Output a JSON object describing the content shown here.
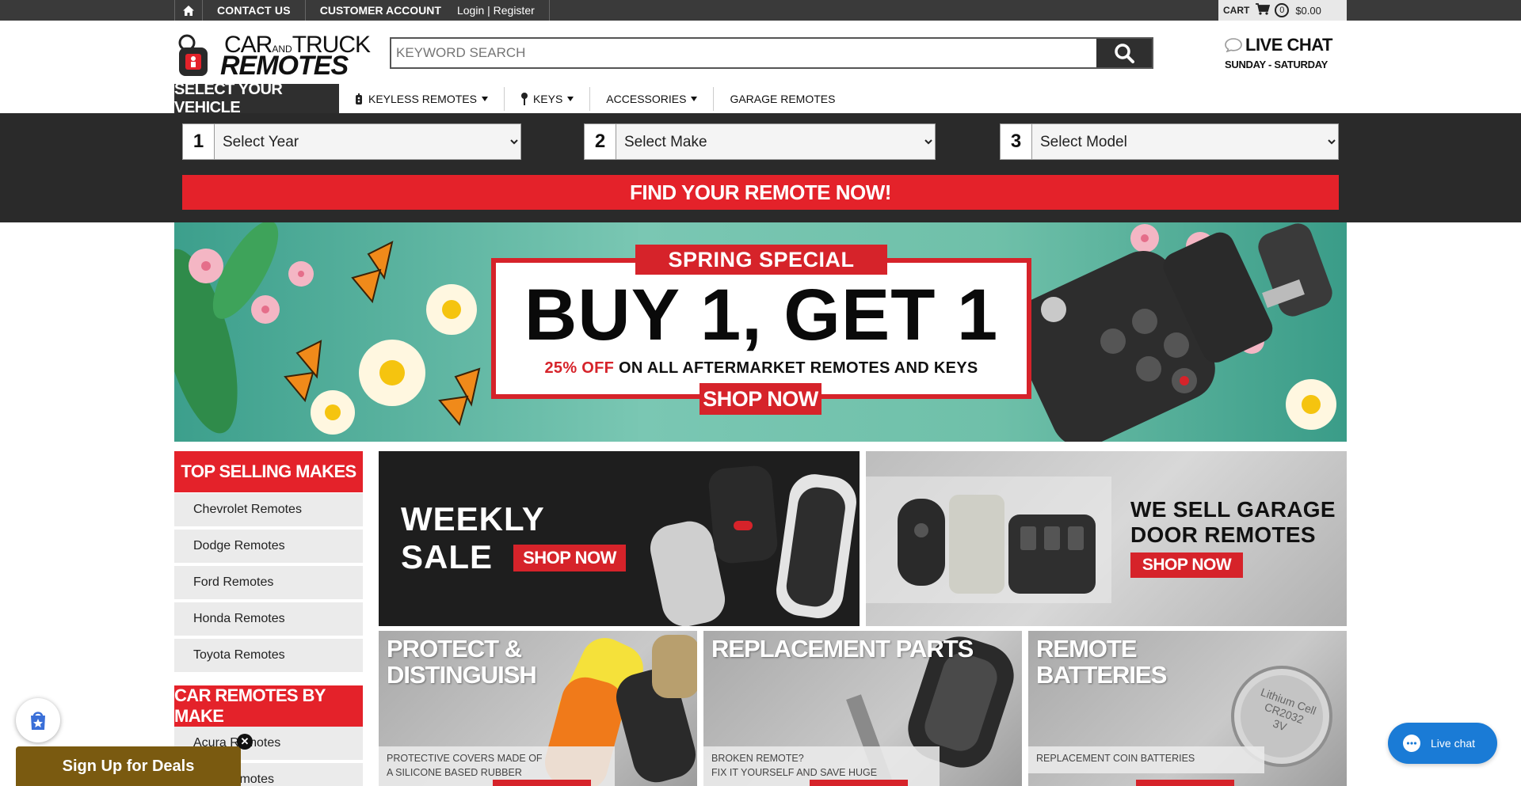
{
  "topbar": {
    "contact": "CONTACT US",
    "account": "CUSTOMER ACCOUNT",
    "login": "Login | Register",
    "cart_label": "CART",
    "cart_count": "0",
    "cart_total": "$0.00"
  },
  "header": {
    "logo_line1": "CAR",
    "logo_and": "AND",
    "logo_line1b": "TRUCK",
    "logo_line2": "REMOTES",
    "search_placeholder": "KEYWORD SEARCH",
    "livechat_title": "LIVE CHAT",
    "livechat_sub": "SUNDAY - SATURDAY"
  },
  "nav": {
    "select_vehicle": "SELECT YOUR VEHICLE",
    "items": [
      {
        "label": "KEYLESS REMOTES"
      },
      {
        "label": "KEYS"
      },
      {
        "label": "ACCESSORIES"
      },
      {
        "label": "GARAGE REMOTES"
      }
    ]
  },
  "vehicle_selector": {
    "steps": [
      {
        "num": "1",
        "value": "Select Year"
      },
      {
        "num": "2",
        "value": "Select Make"
      },
      {
        "num": "3",
        "value": "Select Model"
      }
    ],
    "find_button": "FIND YOUR REMOTE NOW!"
  },
  "hero": {
    "tag": "SPRING SPECIAL",
    "headline": "BUY 1, GET 1",
    "sub_red": "25% OFF",
    "sub_rest": "ON ALL AFTERMARKET REMOTES AND KEYS",
    "shop": "SHOP NOW"
  },
  "sidebar": {
    "top_heading": "TOP SELLING MAKES",
    "top_items": [
      "Chevrolet Remotes",
      "Dodge Remotes",
      "Ford Remotes",
      "Honda Remotes",
      "Toyota Remotes"
    ],
    "by_make_heading": "CAR REMOTES BY MAKE",
    "by_make_items": [
      "Acura Remotes",
      "Remotes"
    ]
  },
  "promos": {
    "weekly_1": "WEEKLY",
    "weekly_2": "SALE",
    "weekly_shop": "SHOP NOW",
    "garage_1": "WE SELL GARAGE",
    "garage_2": "DOOR REMOTES",
    "garage_shop": "SHOP NOW",
    "tiles": [
      {
        "title1": "PROTECT &",
        "title2": "DISTINGUISH",
        "cap1": "PROTECTIVE COVERS MADE OF",
        "cap2": "A SILICONE BASED RUBBER"
      },
      {
        "title1": "REPLACEMENT PARTS",
        "title2": "",
        "cap1": "BROKEN REMOTE?",
        "cap2": "FIX IT YOURSELF AND SAVE HUGE"
      },
      {
        "title1": "REMOTE",
        "title2": "BATTERIES",
        "cap1": "REPLACEMENT COIN BATTERIES",
        "cap2": ""
      }
    ],
    "battery_text1": "Lithium Cell",
    "battery_text2": "CR2032",
    "battery_text3": "3V"
  },
  "floating": {
    "deals": "Sign Up for Deals",
    "close": "✕",
    "chat": "Live chat"
  },
  "colors": {
    "brand_red": "#e4222a",
    "dark": "#2a2a2a",
    "chat_blue": "#1a7bd6"
  }
}
